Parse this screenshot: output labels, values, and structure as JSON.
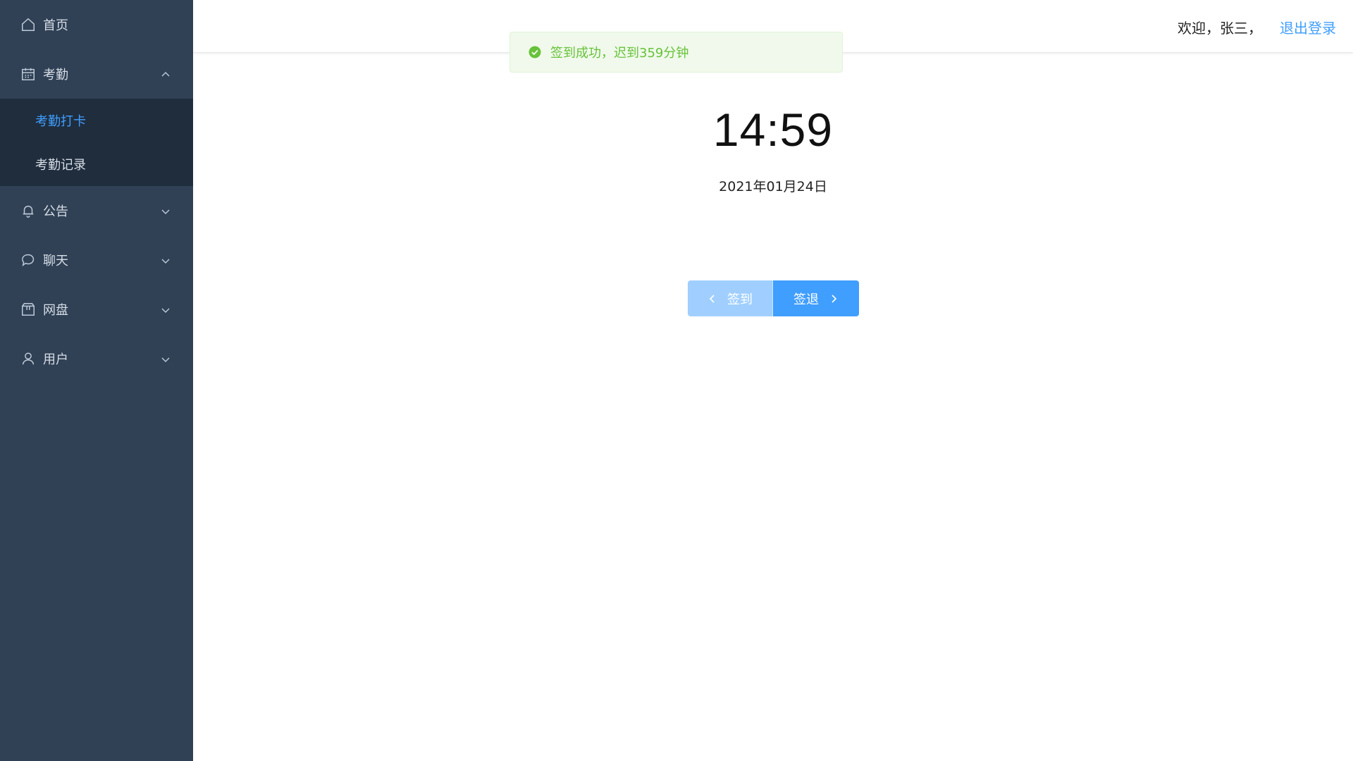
{
  "sidebar": {
    "items": [
      {
        "label": "首页",
        "icon": "home-icon"
      },
      {
        "label": "考勤",
        "icon": "calendar-icon",
        "expanded": true,
        "children": [
          {
            "label": "考勤打卡",
            "active": true
          },
          {
            "label": "考勤记录",
            "active": false
          }
        ]
      },
      {
        "label": "公告",
        "icon": "bell-icon",
        "expanded": false
      },
      {
        "label": "聊天",
        "icon": "chat-icon",
        "expanded": false
      },
      {
        "label": "网盘",
        "icon": "box-icon",
        "expanded": false
      },
      {
        "label": "用户",
        "icon": "user-icon",
        "expanded": false
      }
    ]
  },
  "header": {
    "welcome": "欢迎，张三，",
    "logout": "退出登录"
  },
  "toast": {
    "message": "签到成功，迟到359分钟",
    "type": "success"
  },
  "clock": {
    "time": "14:59",
    "date": "2021年01月24日"
  },
  "actions": {
    "signin_label": "签到",
    "signout_label": "签退"
  },
  "colors": {
    "sidebar_bg": "#304156",
    "accent": "#409eff",
    "success": "#67c23a"
  }
}
